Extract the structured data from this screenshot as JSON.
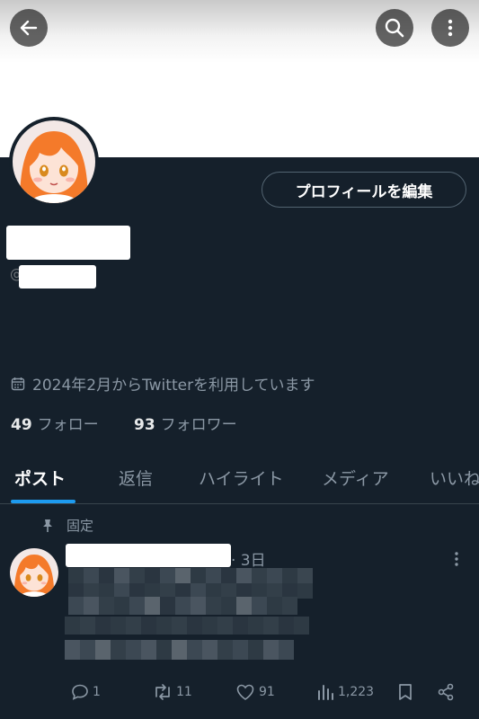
{
  "header": {
    "back_icon": "arrow-left-icon",
    "search_icon": "search-icon",
    "more_icon": "more-vertical-icon"
  },
  "profile": {
    "edit_button_label": "プロフィールを編集",
    "handle_prefix": "@",
    "joined_text": "2024年2月からTwitterを利用しています",
    "following_count": "49",
    "following_label": "フォロー",
    "followers_count": "93",
    "followers_label": "フォロワー"
  },
  "tabs": [
    {
      "label": "ポスト",
      "active": true
    },
    {
      "label": "返信"
    },
    {
      "label": "ハイライト"
    },
    {
      "label": "メディア"
    },
    {
      "label": "いいね"
    }
  ],
  "post": {
    "pinned_label": "固定",
    "time": "· 3日",
    "replies": "1",
    "reposts": "11",
    "likes": "91",
    "views": "1,223"
  },
  "colors": {
    "background": "#15202b",
    "accent": "#1d9bf0",
    "muted_text": "#8b98a5",
    "avatar_hair": "#f47a2a"
  }
}
